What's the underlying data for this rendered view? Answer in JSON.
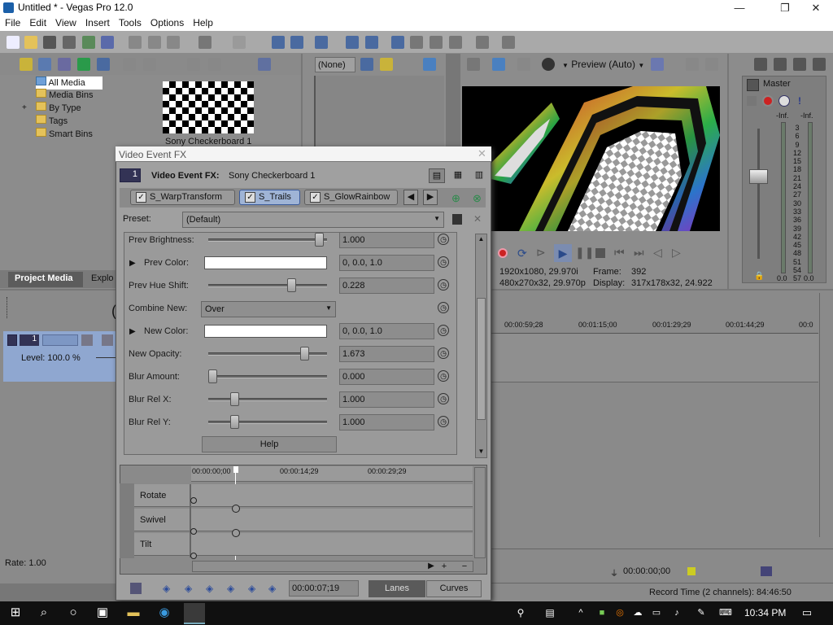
{
  "window": {
    "title": "Untitled * - Vegas Pro 12.0",
    "minimize": "—",
    "maximize": "❐",
    "close": "✕"
  },
  "menu": [
    "File",
    "Edit",
    "View",
    "Insert",
    "Tools",
    "Options",
    "Help"
  ],
  "project_media": {
    "tree": [
      "All Media",
      "Media Bins",
      "By Type",
      "Tags",
      "Smart Bins"
    ],
    "expand_glyph": "+",
    "thumbnail_caption": "Sony Checkerboard 1",
    "tabs": [
      "Project Media",
      "Explo"
    ]
  },
  "trimmer": {
    "dropdown": "(None)"
  },
  "preview": {
    "mode": "Preview (Auto)",
    "project_info": "1920x1080, 29.970i",
    "preview_info": "480x270x32, 29.970p",
    "frame_label": "Frame:",
    "frame_value": "392",
    "display_label": "Display:",
    "display_value": "317x178x32, 24.922"
  },
  "master": {
    "title": "Master",
    "peak_left": "-Inf.",
    "peak_right": "-Inf.",
    "scale": [
      "3",
      "6",
      "9",
      "12",
      "15",
      "18",
      "21",
      "24",
      "27",
      "30",
      "33",
      "36",
      "39",
      "42",
      "45",
      "48",
      "51",
      "54",
      "57"
    ],
    "level_left": "0.0",
    "level_right": "0.0"
  },
  "track": {
    "level": "Level: 100.0 %",
    "rate": "Rate: 1.00",
    "number": "1",
    "paren": "("
  },
  "timeline": {
    "ruler": [
      "00:00:59;28",
      "00:01:15;00",
      "00:01:29;29",
      "00:01:44;29",
      "00:0"
    ],
    "cursor_time": "00:00:00;00",
    "record_time": "Record Time (2 channels): 84:46:50"
  },
  "fx": {
    "window_title": "Video Event FX",
    "header_label": "Video Event FX:",
    "header_value": "Sony Checkerboard 1",
    "chain_index": "1",
    "chain": [
      "S_WarpTransform",
      "S_Trails",
      "S_GlowRainbow"
    ],
    "preset_label": "Preset:",
    "preset_value": "(Default)",
    "params": [
      {
        "label": "Prev Brightness:",
        "value": "1.000",
        "level": 0.97
      },
      {
        "label": "Prev Color:",
        "value": "0, 0.0, 1.0",
        "swatch": "#ffffff"
      },
      {
        "label": "Prev Hue Shift:",
        "value": "0.228",
        "level": 0.72
      },
      {
        "label": "Combine New:",
        "value": "Over"
      },
      {
        "label": "New Color:",
        "value": "0, 0.0, 1.0",
        "swatch": "#ffffff"
      },
      {
        "label": "New Opacity:",
        "value": "1.673",
        "level": 0.84
      },
      {
        "label": "Blur Amount:",
        "value": "0.000",
        "level": 0.0
      },
      {
        "label": "Blur Rel X:",
        "value": "1.000",
        "level": 0.2
      },
      {
        "label": "Blur Rel Y:",
        "value": "1.000",
        "level": 0.2
      }
    ],
    "help_label": "Help",
    "keyframe_ruler": [
      "00:00:00;00",
      "00:00:14;29",
      "00:00:29;29"
    ],
    "keyframe_tracks": [
      "Rotate",
      "Swivel",
      "Tilt"
    ],
    "bottom_time": "00:00:07;19",
    "lanes_label": "Lanes",
    "curves_label": "Curves"
  },
  "taskbar": {
    "clock": "10:34 PM"
  },
  "colors": {
    "selected_blue": "#4a7fc2",
    "accent_red": "#cc2222"
  }
}
